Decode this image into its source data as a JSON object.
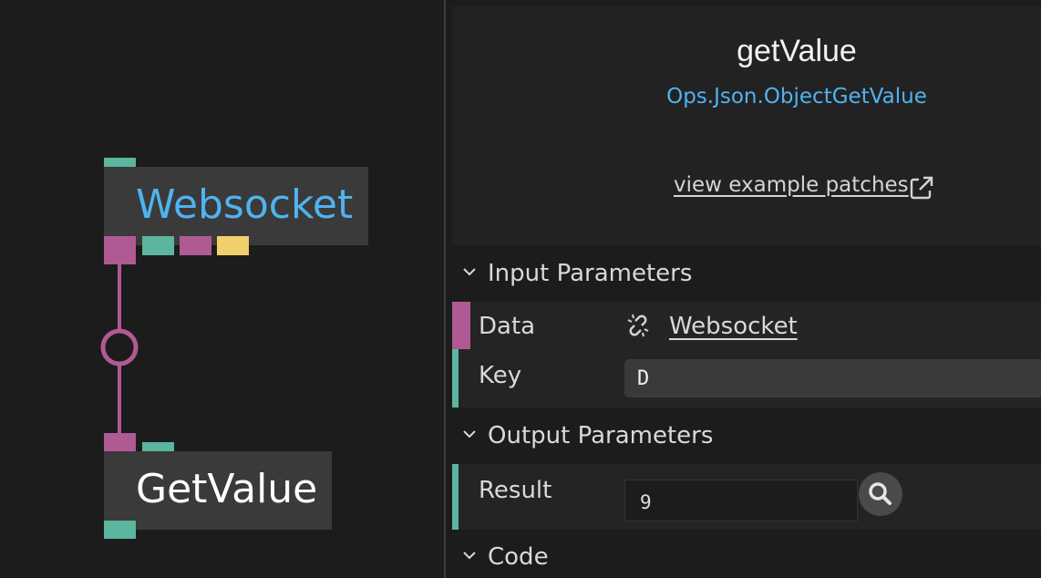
{
  "colors": {
    "object_port": "#b05a93",
    "trigger_port": "#5cb59e",
    "string_port": "#f0d06c",
    "link_blue": "#4fb3f0",
    "node_bg": "#3a3a3a"
  },
  "canvas": {
    "nodes": [
      {
        "title": "Websocket",
        "title_color": "#4fb3f0"
      },
      {
        "title": "GetValue",
        "title_color": "#ffffff"
      }
    ]
  },
  "inspector": {
    "op_title": "getValue",
    "op_path": "Ops.Json.ObjectGetValue",
    "example_link": "view example patches",
    "external_icon": "external-link-icon",
    "sections": {
      "input": "Input Parameters",
      "output": "Output Parameters",
      "code": "Code"
    },
    "inputs": [
      {
        "label": "Data",
        "link_icon": "unlink-icon",
        "link_text": "Websocket"
      },
      {
        "label": "Key",
        "value": "D"
      }
    ],
    "outputs": [
      {
        "label": "Result",
        "value": "9",
        "action_icon": "search-icon"
      }
    ]
  }
}
